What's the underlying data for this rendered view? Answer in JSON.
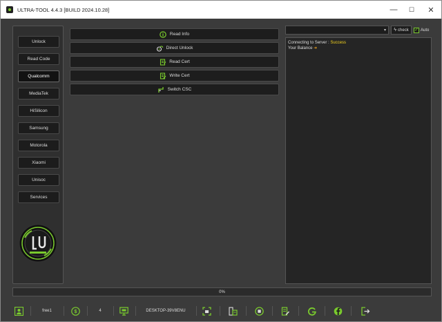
{
  "window": {
    "title": "ULTRA-TOOL 4.4.3 [BUILD 2024.10.28]",
    "minimize": "—",
    "maximize": "☐",
    "close": "✕"
  },
  "sidebar": {
    "items": [
      {
        "label": "Unlock"
      },
      {
        "label": "Read Code"
      },
      {
        "label": "Qualcomm"
      },
      {
        "label": "MediaTek"
      },
      {
        "label": "HiSilicon"
      },
      {
        "label": "Samsung"
      },
      {
        "label": "Motorola"
      },
      {
        "label": "Xiaomi"
      },
      {
        "label": "Unisoc"
      },
      {
        "label": "Services"
      }
    ],
    "active": "Qualcomm"
  },
  "actions": [
    {
      "label": "Read Info",
      "icon": "info-icon"
    },
    {
      "label": "Direct Unlock",
      "icon": "unlock-icon"
    },
    {
      "label": "Read Cert",
      "icon": "cert-icon"
    },
    {
      "label": "Write Cert",
      "icon": "write-cert-icon"
    },
    {
      "label": "Switch CSC",
      "icon": "switch-icon"
    }
  ],
  "top_right": {
    "combo_value": "",
    "check_label": "check",
    "auto_label": "Auto",
    "auto_checked": true
  },
  "log": {
    "line1_prefix": "Connecting to Server : ",
    "line1_status": "Success",
    "line2_prefix": "Your Balance ",
    "line2_arrow": "➜"
  },
  "progress": {
    "text": "0%",
    "value": 0
  },
  "status": {
    "user": "free1",
    "credits": "4",
    "computer": "DESKTOP-39V8ENU"
  },
  "colors": {
    "accent": "#7acb2d",
    "success": "#f3d21e",
    "background": "#3b3b3b"
  }
}
